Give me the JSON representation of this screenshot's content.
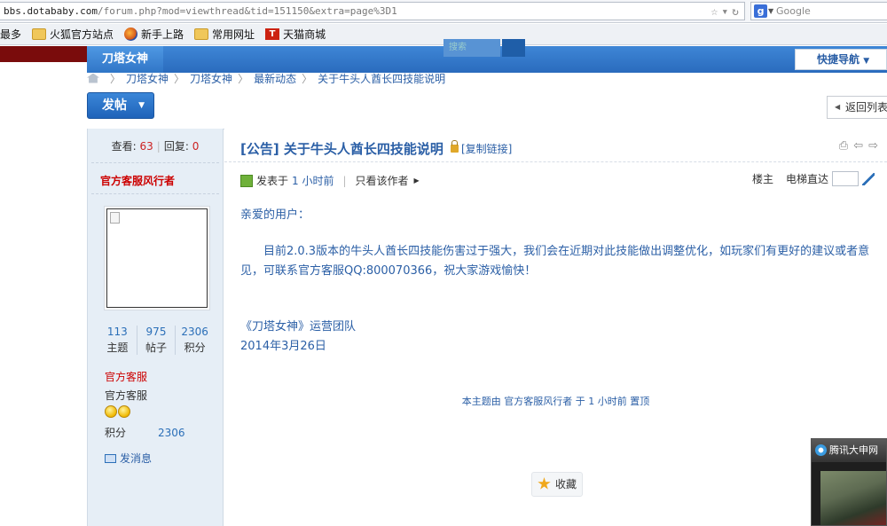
{
  "browser": {
    "url_domain": "bbs.dotababy.com",
    "url_path": "/forum.php?mod=viewthread&tid=151150&extra=page%3D1",
    "url_scheme": "",
    "search_engine": "Google",
    "search_engine_initial": "g",
    "icons": [
      "star-icon",
      "dropdown-icon",
      "reload-icon"
    ]
  },
  "bookmarks": [
    {
      "label": "最多",
      "icon": "none"
    },
    {
      "label": "火狐官方站点",
      "icon": "folder-icon"
    },
    {
      "label": "新手上路",
      "icon": "firefox-icon"
    },
    {
      "label": "常用网址",
      "icon": "folder-icon"
    },
    {
      "label": "天猫商城",
      "icon": "tmall-icon",
      "icon_text": "T"
    }
  ],
  "header": {
    "site_tab": "刀塔女神",
    "search_placeholder": "搜索",
    "quick_nav": "快捷导航",
    "colors": {
      "red": "#7a0c0c",
      "blue": "#2a6bbd"
    }
  },
  "breadcrumb": [
    "刀塔女神",
    "刀塔女神",
    "最新动态",
    "关于牛头人酋长四技能说明"
  ],
  "breadcrumb_sep": "〉",
  "actions": {
    "post": "发帖",
    "back": "返回列表"
  },
  "sidebar": {
    "views_label": "查看:",
    "views": "63",
    "replies_label": "回复:",
    "replies": "0",
    "author": "官方客服风行者",
    "counts": [
      {
        "n": "113",
        "l": "主题"
      },
      {
        "n": "975",
        "l": "帖子"
      },
      {
        "n": "2306",
        "l": "积分"
      }
    ],
    "group_title": "官方客服",
    "group": "官方客服",
    "points_label": "积分",
    "points": "2306",
    "message": "发消息"
  },
  "post": {
    "title": "[公告] 关于牛头人酋长四技能说明",
    "copy_link": "[复制链接]",
    "posted_prefix": "发表于",
    "posted_time": "1 小时前",
    "only_author": "只看该作者",
    "floor": "楼主",
    "elevator": "电梯直达",
    "greeting": "亲爱的用户：",
    "paragraph": "目前2.0.3版本的牛头人酋长四技能伤害过于强大，我们会在近期对此技能做出调整优化，如玩家们有更好的建议或者意见，可联系官方客服QQ:800070366，祝大家游戏愉快！",
    "signature": "《刀塔女神》运营团队",
    "date": "2014年3月26日",
    "sticky_note": "本主题由 官方客服风行者 于 1 小时前 置顶",
    "favorite": "收藏"
  },
  "popup": {
    "title": "腾讯大申网"
  }
}
